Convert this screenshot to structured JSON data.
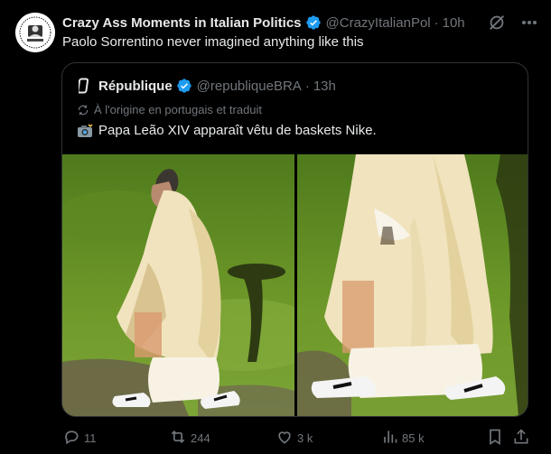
{
  "post": {
    "author_name": "Crazy Ass Moments in Italian Politics",
    "author_handle": "@CrazyItalianPol",
    "separator": "·",
    "time": "10h",
    "text": "Paolo Sorrentino never imagined anything like this"
  },
  "quoted": {
    "author_name": "République",
    "author_handle": "@republiqueBRA",
    "separator": "·",
    "time": "13h",
    "translation_note": "À l'origine en portugais et traduit",
    "text": "Papa Leão XIV apparaît vêtu de baskets Nike."
  },
  "actions": {
    "replies": "11",
    "reposts": "244",
    "likes": "3 k",
    "views": "85 k"
  },
  "colors": {
    "background": "#000000",
    "text": "#e7e9ea",
    "secondary": "#71767b",
    "verified": "#1d9bf0",
    "border": "#2f3336"
  },
  "icons": [
    "verified-badge-icon",
    "grok-icon",
    "more-icon",
    "translate-icon",
    "camera-emoji-icon",
    "reply-icon",
    "repost-icon",
    "like-icon",
    "views-icon",
    "bookmark-icon",
    "share-icon"
  ]
}
